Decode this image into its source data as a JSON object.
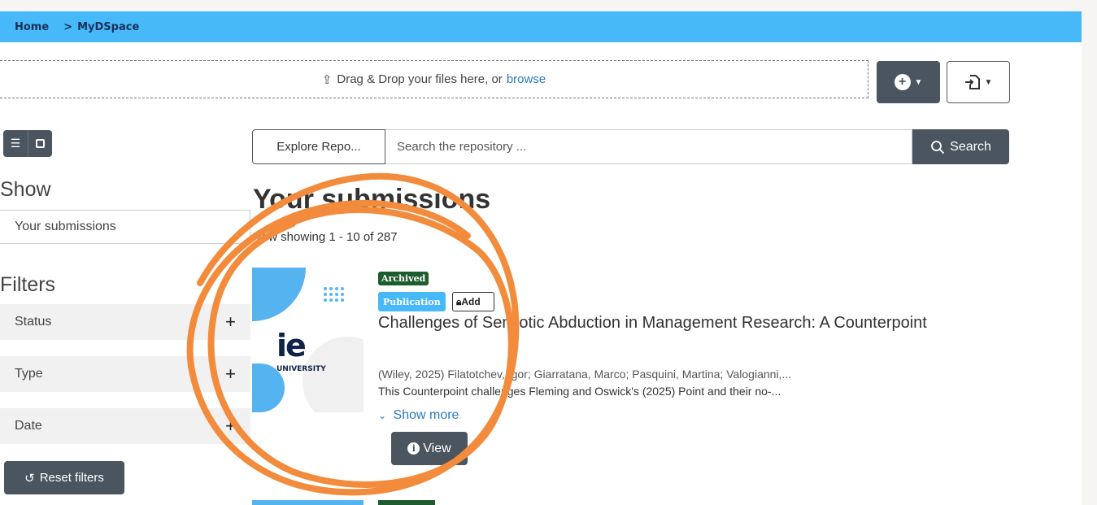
{
  "breadcrumb": {
    "home": "Home",
    "separator": ">",
    "current": "MyDSpace"
  },
  "dropzone": {
    "text": "Drag & Drop your files here, or",
    "browse_link": "browse",
    "icon": "upload-icon"
  },
  "toolbar": {
    "add_icon": "plus-circle-icon",
    "import_icon": "file-import-icon"
  },
  "sidebar": {
    "show_label": "Show",
    "show_select_value": "Your submissions",
    "filters_label": "Filters",
    "facets": [
      {
        "label": "Status",
        "toggle": "+"
      },
      {
        "label": "Type",
        "toggle": "+"
      },
      {
        "label": "Date",
        "toggle": "+"
      }
    ],
    "reset_label": "Reset filters"
  },
  "search": {
    "scope_label": "Explore Repo...",
    "placeholder": "Search the repository ...",
    "button_label": "Search"
  },
  "main": {
    "title": "Your submissions",
    "result_count": "Now showing 1 - 10 of 287"
  },
  "item": {
    "thumbnail_logo": "ie",
    "thumbnail_sub": "UNIVERSITY",
    "status_badge": "Archived",
    "type_badge": "Publication",
    "extra_badge": "Add",
    "title": "Challenges of Semiotic Abduction in Management Research: A Counterpoint",
    "authors": "(Wiley, 2025) Filatotchev, Igor; Giarratana, Marco; Pasquini, Martina; Valogianni,...",
    "abstract": "This Counterpoint challenges Fleming and Oswick's (2025) Point and their no-...",
    "show_more": "Show more",
    "view_label": "View"
  },
  "colors": {
    "navbar": "#48b9f8",
    "button_dark": "#4a5560",
    "archived": "#1d5c2e",
    "annotation": "#f28c3c"
  }
}
